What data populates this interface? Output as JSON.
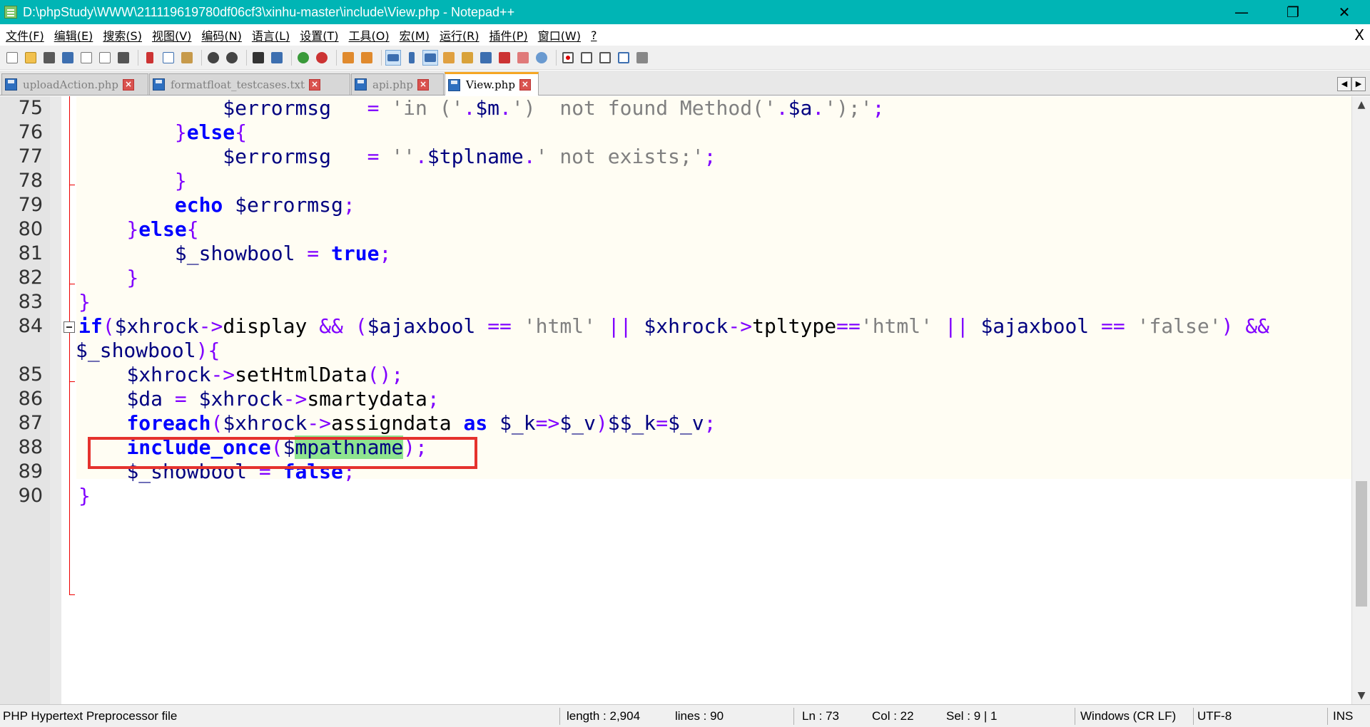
{
  "window": {
    "title": "D:\\phpStudy\\WWW\\211119619780df06cf3\\xinhu-master\\include\\View.php - Notepad++",
    "minimize": "—",
    "maximize": "❐",
    "close": "✕"
  },
  "menu": [
    "文件(F)",
    "编辑(E)",
    "搜索(S)",
    "视图(V)",
    "编码(N)",
    "语言(L)",
    "设置(T)",
    "工具(O)",
    "宏(M)",
    "运行(R)",
    "插件(P)",
    "窗口(W)",
    "?"
  ],
  "menu_close": "X",
  "tabs": [
    {
      "label": "uploadAction.php",
      "active": false
    },
    {
      "label": "formatfloat_testcases.txt",
      "active": false
    },
    {
      "label": "api.php",
      "active": false
    },
    {
      "label": "View.php",
      "active": true
    }
  ],
  "tab_nav": {
    "prev": "◀",
    "next": "▶"
  },
  "scroll": {
    "up": "▲",
    "down": "▼"
  },
  "line_numbers": [
    "75",
    "76",
    "77",
    "78",
    "79",
    "80",
    "81",
    "82",
    "83",
    "84",
    "",
    "85",
    "86",
    "87",
    "88",
    "89",
    "90"
  ],
  "highlight_word": "mpathname",
  "status": {
    "file_type": "PHP Hypertext Preprocessor file",
    "length": "length : 2,904",
    "lines": "lines : 90",
    "ln": "Ln : 73",
    "col": "Col : 22",
    "sel": "Sel : 9 | 1",
    "eol": "Windows (CR LF)",
    "encoding": "UTF-8",
    "mode": "INS"
  },
  "colors": {
    "titlebar": "#00b5b5",
    "keyword": "#0000ff",
    "variable": "#000080",
    "string": "#808080",
    "operator": "#8000ff",
    "highlight": "#8fe48f",
    "annotation_box": "#e5322d"
  }
}
